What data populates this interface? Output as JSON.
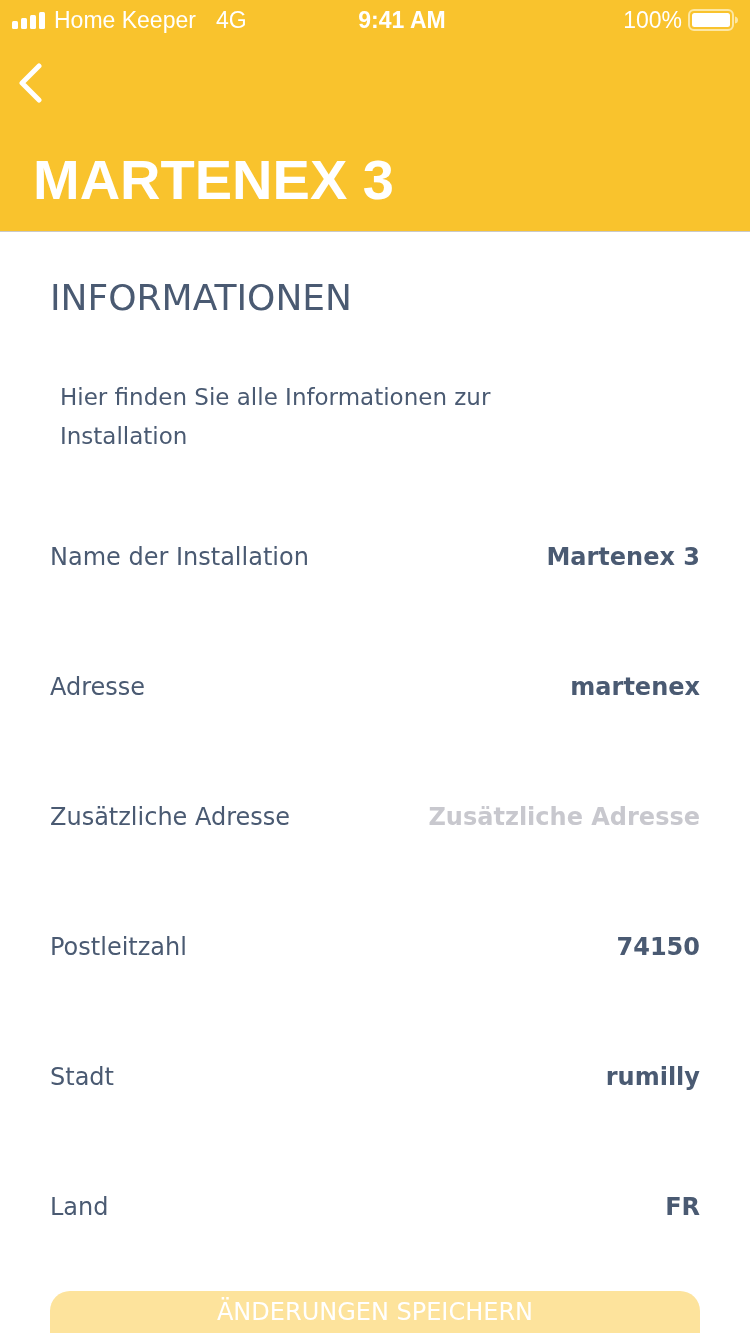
{
  "status_bar": {
    "carrier": "Home Keeper",
    "network": "4G",
    "time": "9:41 AM",
    "battery": "100%"
  },
  "header": {
    "title": "MARTENEX 3"
  },
  "section": {
    "title": "INFORMATIONEN",
    "description": "Hier finden Sie alle Informationen zur Installation"
  },
  "fields": [
    {
      "label": "Name der Installation",
      "value": "Martenex 3"
    },
    {
      "label": "Adresse",
      "value": "martenex"
    },
    {
      "label": "Zusätzliche Adresse",
      "placeholder": "Zusätzliche Adresse"
    },
    {
      "label": "Postleitzahl",
      "value": "74150"
    },
    {
      "label": "Stadt",
      "value": "rumilly"
    },
    {
      "label": "Land",
      "value": "FR"
    }
  ],
  "save_button": {
    "label": "ÄNDERUNGEN SPEICHERN",
    "disabled": true
  }
}
